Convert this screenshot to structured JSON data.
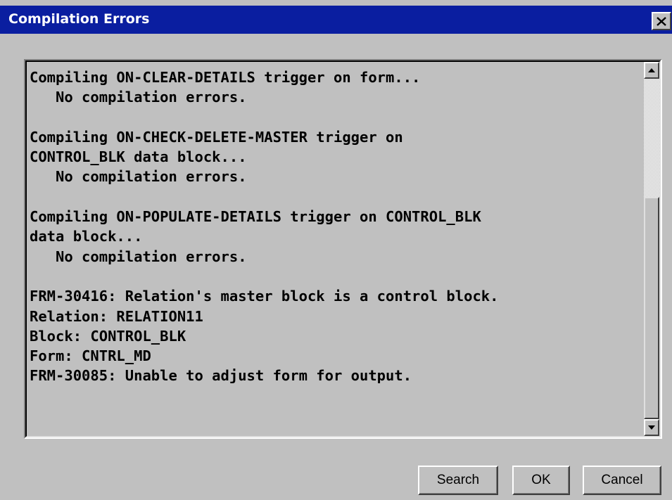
{
  "window": {
    "title": "Compilation Errors",
    "close_icon": "close-icon"
  },
  "log": {
    "lines": [
      "Compiling ON-CLEAR-DETAILS trigger on form...",
      "   No compilation errors.",
      "",
      "Compiling ON-CHECK-DELETE-MASTER trigger on",
      "CONTROL_BLK data block...",
      "   No compilation errors.",
      "",
      "Compiling ON-POPULATE-DETAILS trigger on CONTROL_BLK",
      "data block...",
      "   No compilation errors.",
      "",
      "FRM-30416: Relation's master block is a control block.",
      "Relation: RELATION11",
      "Block: CONTROL_BLK",
      "Form: CNTRL_MD",
      "FRM-30085: Unable to adjust form for output."
    ]
  },
  "scrollbar": {
    "up_icon": "scroll-up-arrow-icon",
    "down_icon": "scroll-down-arrow-icon"
  },
  "buttons": {
    "search_label": "Search",
    "ok_label": "OK",
    "cancel_label": "Cancel"
  },
  "colors": {
    "titlebar": "#0a1ea0",
    "face": "#c0c0c0"
  }
}
